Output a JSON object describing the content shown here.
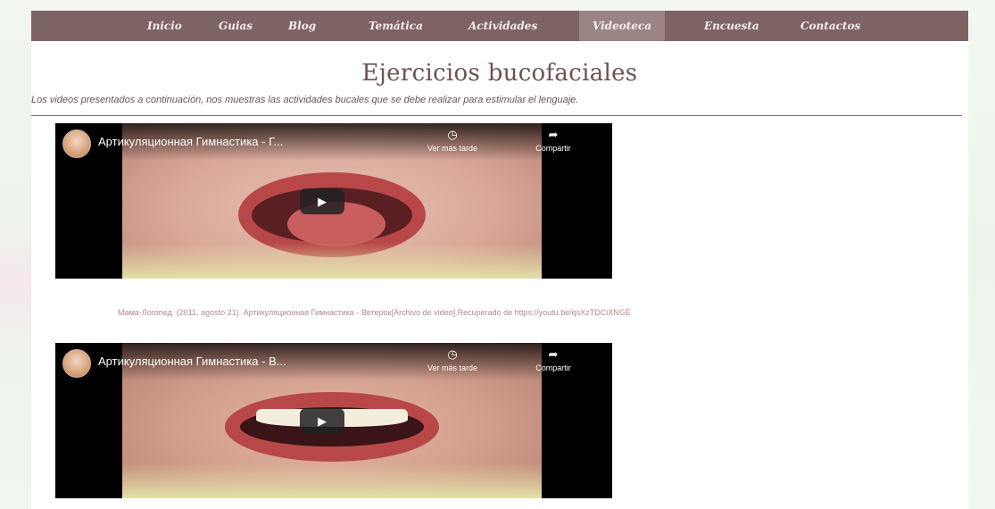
{
  "nav": {
    "items": [
      {
        "label": "Inicio",
        "active": false
      },
      {
        "label": "Guias",
        "active": false
      },
      {
        "label": "Blog",
        "active": false
      },
      {
        "label": "Temática",
        "active": false
      },
      {
        "label": "Actividades",
        "active": false
      },
      {
        "label": "Videoteca",
        "active": true
      },
      {
        "label": "Encuesta",
        "active": false
      },
      {
        "label": "Contactos",
        "active": false
      }
    ]
  },
  "page": {
    "title": "Ejercicios bucofaciales",
    "intro": "Los videos presentados a continuación, nos muestras las actividades bucales que se debe realizar para estimular el lenguaje."
  },
  "videos": [
    {
      "title": "Артикуляционная Гимнастика - Г...",
      "watch_later": "Ver más tarde",
      "share": "Compartir",
      "avatar_icon": "channel-avatar",
      "play_icon": "play-icon"
    },
    {
      "title": "Артикуляционная Гимнастика - В...",
      "watch_later": "Ver más tarde",
      "share": "Compartir",
      "avatar_icon": "channel-avatar",
      "play_icon": "play-icon"
    }
  ],
  "citation": "Мама-Логопед. (2011, agosto 21). Артикуляционная Гимнастика - Ветерок[Archivo de video].Recuperado de https://youtu.be/qsXzTDCiXNGE",
  "colors": {
    "nav_bg": "#7d6363",
    "nav_active": "#9b8484",
    "title": "#6e5252",
    "citation": "#b08a8a"
  }
}
